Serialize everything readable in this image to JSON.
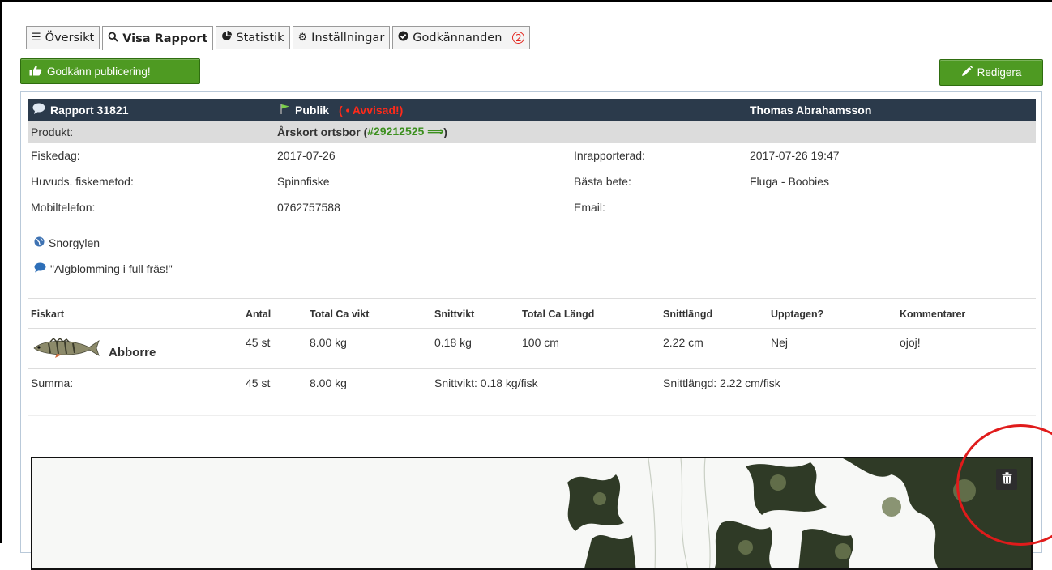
{
  "tabs": [
    {
      "label": "Översikt",
      "icon": "list-icon"
    },
    {
      "label": "Visa Rapport",
      "icon": "search-icon",
      "active": true
    },
    {
      "label": "Statistik",
      "icon": "pie-chart-icon"
    },
    {
      "label": "Inställningar",
      "icon": "cogs-icon"
    },
    {
      "label": "Godkännanden",
      "icon": "check-circle-icon",
      "badge": "2"
    }
  ],
  "toolbar": {
    "approve_label": "Godkänn publicering!",
    "edit_label": "Redigera"
  },
  "report": {
    "title": "Rapport 31821",
    "visibility": "Publik",
    "status": "( • Avvisad!)",
    "author": "Thomas Abrahamsson",
    "product_label": "Produkt:",
    "product_name": "Årskort ortsbor (",
    "product_link": "#29212525 ⟹",
    "product_close": ")",
    "fields": {
      "fiskedag_label": "Fiskedag:",
      "fiskedag_value": "2017-07-26",
      "inrapporterad_label": "Inrapporterad:",
      "inrapporterad_value": "2017-07-26 19:47",
      "metod_label": "Huvuds. fiskemetod:",
      "metod_value": "Spinnfiske",
      "bete_label": "Bästa bete:",
      "bete_value": "Fluga - Boobies",
      "mobil_label": "Mobiltelefon:",
      "mobil_value": "0762757588",
      "email_label": "Email:",
      "email_value": ""
    },
    "location": "Snorgylen",
    "comment": "\"Algblomming i full fräs!\""
  },
  "fish_table": {
    "headers": [
      "Fiskart",
      "Antal",
      "Total Ca vikt",
      "Snittvikt",
      "Total Ca Längd",
      "Snittlängd",
      "Upptagen?",
      "Kommentarer"
    ],
    "rows": [
      {
        "species": "Abborre",
        "antal": "45 st",
        "total_vikt": "8.00 kg",
        "snittvikt": "0.18 kg",
        "total_langd": "100 cm",
        "snittlangd": "2.22 cm",
        "upptagen": "Nej",
        "kommentar": "ojoj!"
      }
    ],
    "sum": {
      "label": "Summa:",
      "antal": "45 st",
      "total_vikt": "8.00 kg",
      "snittvikt": "Snittvikt: 0.18 kg/fisk",
      "snittlangd": "Snittlängd: 2.22 cm/fisk"
    }
  },
  "colors": {
    "accent_green": "#4e9a22",
    "header_dark": "#2b3a4b",
    "rejected_red": "#ff2a1a",
    "link_green": "#3c8f1e",
    "annotation_red": "#e01b1b"
  }
}
